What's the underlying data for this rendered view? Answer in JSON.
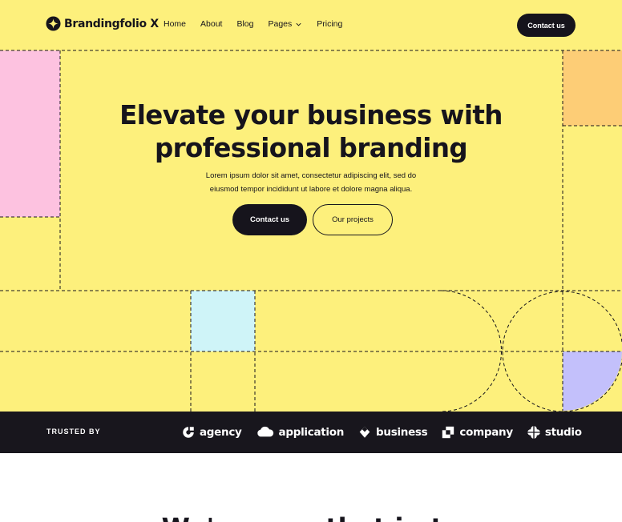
{
  "brand": {
    "name": "Brandingfolio X"
  },
  "nav": {
    "items": [
      {
        "label": "Home"
      },
      {
        "label": "About"
      },
      {
        "label": "Blog"
      },
      {
        "label": "Pages"
      },
      {
        "label": "Pricing"
      }
    ],
    "cta_label": "Contact us"
  },
  "hero": {
    "title_line1": "Elevate your business with",
    "title_line2": "professional branding",
    "subtitle_line1": "Lorem ipsum dolor sit amet, consectetur adipiscing elit, sed do",
    "subtitle_line2": "eiusmod tempor incididunt ut labore et dolore magna aliqua.",
    "primary_button": "Contact us",
    "secondary_button": "Our projects"
  },
  "trusted": {
    "label": "TRUSTED BY",
    "logos": [
      {
        "name": "agency",
        "icon": "agency-logo-icon"
      },
      {
        "name": "application",
        "icon": "cloud-icon"
      },
      {
        "name": "business",
        "icon": "diamond-icon"
      },
      {
        "name": "company",
        "icon": "squares-icon"
      },
      {
        "name": "studio",
        "icon": "flower-icon"
      }
    ]
  },
  "next_section": {
    "title": "We're sure that in te"
  },
  "colors": {
    "background": "#fdf07c",
    "dark": "#16141c",
    "pink": "#fdc2e0",
    "orange": "#fdcd76",
    "cyan": "#cff4f8",
    "lavender": "#c3c0fb"
  }
}
